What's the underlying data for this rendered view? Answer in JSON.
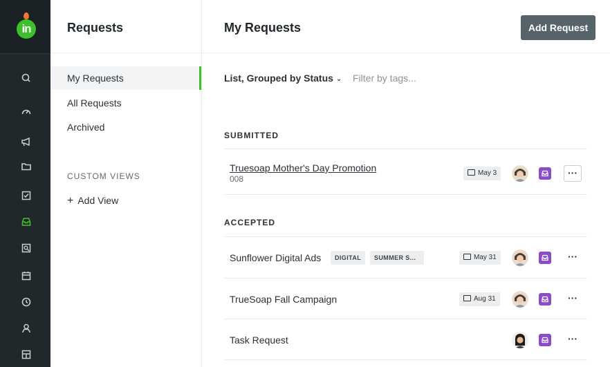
{
  "sidebar": {
    "title": "Requests",
    "items": [
      {
        "label": "My Requests",
        "active": true
      },
      {
        "label": "All Requests",
        "active": false
      },
      {
        "label": "Archived",
        "active": false
      }
    ],
    "custom_views_label": "CUSTOM VIEWS",
    "add_view_label": "Add View",
    "add_view_icon": "+"
  },
  "rail": {
    "logo_text": "in",
    "icons": [
      "search-icon",
      "dashboard-icon",
      "megaphone-icon",
      "folder-icon",
      "checkbox-icon",
      "inbox-icon",
      "review-icon",
      "calendar-icon",
      "clock-icon",
      "user-icon",
      "reports-icon"
    ],
    "active_icon": "inbox-icon"
  },
  "main": {
    "title": "My Requests",
    "add_button_label": "Add Request",
    "grouping_label": "List, Grouped by Status",
    "grouping_chevron": "⌄",
    "filter_placeholder": "Filter by tags..."
  },
  "sections": [
    {
      "label": "SUBMITTED",
      "rows": [
        {
          "title": "Truesoap Mother's Day Promotion",
          "subtitle": "008",
          "tags": [],
          "date": "May 3",
          "more": "···"
        }
      ]
    },
    {
      "label": "ACCEPTED",
      "rows": [
        {
          "title": "Sunflower Digital Ads",
          "subtitle": "",
          "tags": [
            "DIGITAL",
            "SUMMER S..."
          ],
          "date": "May 31",
          "more": "···"
        },
        {
          "title": "TrueSoap Fall Campaign",
          "subtitle": "",
          "tags": [],
          "date": "Aug 31",
          "more": "···"
        },
        {
          "title": "Task Request",
          "subtitle": "",
          "tags": [],
          "date": "",
          "more": "···"
        }
      ]
    }
  ],
  "colors": {
    "rail_bg": "#20282c",
    "accent_green": "#3fbf2b",
    "button_bg": "#56636b",
    "inbox_purple": "#8b4cc9",
    "logo_orange": "#f0782a"
  }
}
